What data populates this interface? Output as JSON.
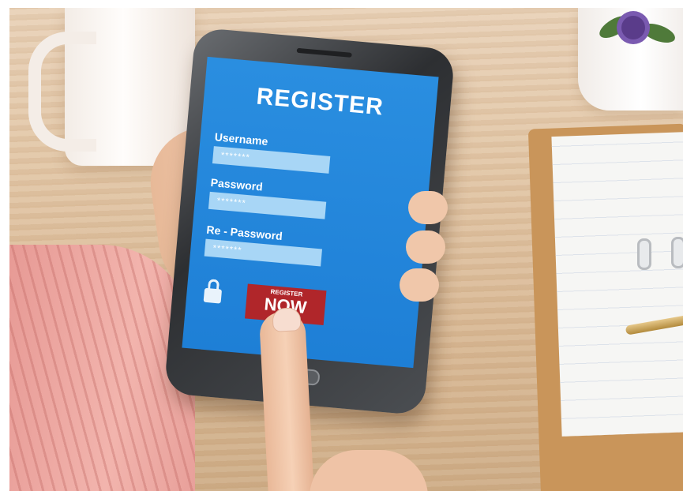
{
  "screen": {
    "title": "REGISTER",
    "fields": [
      {
        "label": "Username",
        "value": "*******"
      },
      {
        "label": "Password",
        "value": "*******"
      },
      {
        "label": "Re - Password",
        "value": "*******"
      }
    ],
    "button_small": "REGISTER",
    "button_big": "NOW"
  },
  "colors": {
    "screen_blue": "#1e7fd6",
    "field_fill": "#a8d6f6",
    "button_red": "#b0262a",
    "sweater_pink": "#f2b4ad",
    "table_wood": "#dfc3a2"
  },
  "icons": [
    "lock-icon",
    "home-button"
  ]
}
